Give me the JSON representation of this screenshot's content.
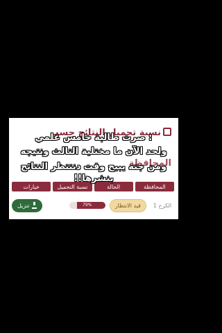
{
  "page": {
    "title": "نسبة تحميل النتائج حسب",
    "subtitle": "المحافظة"
  },
  "table": {
    "headers": [
      "المحافظة",
      "الحالة",
      "نسبة التحميل",
      "خيارات"
    ],
    "row": {
      "governorate": "الكرخ 1",
      "status": "قيد الانتظار",
      "progress_label": "79%",
      "progress_value": 0.79,
      "download_label": "تنزيل"
    }
  },
  "overlay": {
    "line1": ": صرت طالبة خامس علمي",
    "line2": "ولحد الآن ما مختلية التالث ونتيجه",
    "line3": "ومن جنه يبيح وقت دنتتظر النتائج بنشرها!!"
  },
  "colors": {
    "accent": "#8b2c3d",
    "status_badge": "#f1d9a4",
    "download_button": "#2f6b3b"
  }
}
